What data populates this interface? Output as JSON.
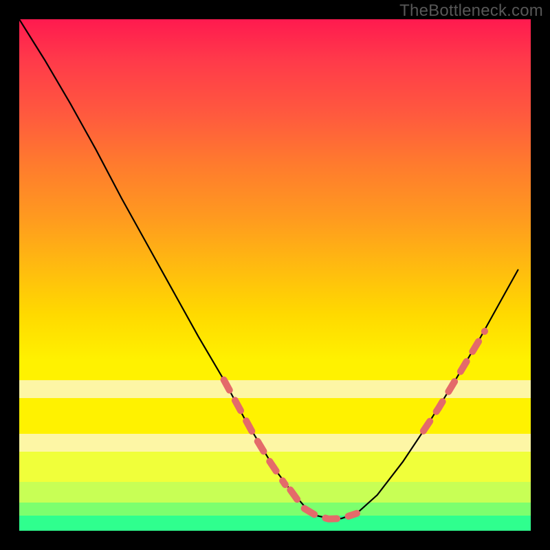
{
  "watermark": "TheBottleneck.com",
  "chart_data": {
    "type": "line",
    "title": "",
    "xlabel": "",
    "ylabel": "",
    "xlim": [
      0,
      100
    ],
    "ylim": [
      0,
      100
    ],
    "series": [
      {
        "name": "bottleneck-curve",
        "x": [
          0,
          5,
          10,
          15,
          20,
          25,
          30,
          35,
          40,
          44,
          47,
          50,
          53,
          56,
          58,
          61,
          63,
          66,
          70,
          75,
          80,
          85,
          90,
          95,
          97.5
        ],
        "y": [
          100,
          92,
          83.5,
          74.5,
          65,
          56,
          47,
          38,
          29.5,
          22,
          17,
          12,
          8,
          4.5,
          3,
          2.3,
          2.4,
          3.4,
          7,
          13.5,
          21,
          29,
          37.5,
          46.5,
          51
        ]
      }
    ],
    "highlight_segments": [
      {
        "name": "left-dashed",
        "x": [
          40,
          43,
          46,
          49,
          52
        ],
        "y": [
          29.5,
          24,
          18.5,
          13.5,
          9
        ]
      },
      {
        "name": "bottom-dashed",
        "x": [
          53,
          55.5,
          58,
          60.5,
          63,
          66
        ],
        "y": [
          8,
          4.5,
          3,
          2.3,
          2.4,
          3.4
        ]
      },
      {
        "name": "right-dashed",
        "x": [
          79,
          82,
          85,
          88,
          91
        ],
        "y": [
          19.5,
          24,
          29,
          34,
          39
        ]
      }
    ],
    "colors": {
      "curve": "#000000",
      "highlight": "#e46a6a",
      "gradient_top": "#ff1a4f",
      "gradient_mid": "#fff200",
      "gradient_bottom": "#2fff8e",
      "frame": "#000000"
    }
  }
}
